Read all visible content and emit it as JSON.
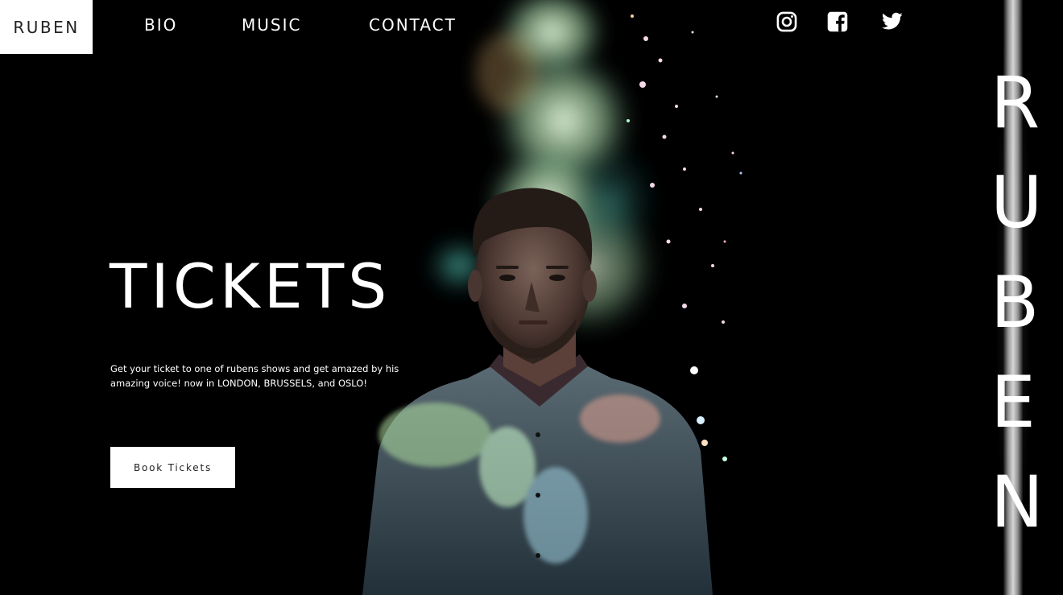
{
  "brand": {
    "logo_text": "RUBEN"
  },
  "nav": {
    "items": [
      {
        "label": "BIO"
      },
      {
        "label": "MUSIC"
      },
      {
        "label": "CONTACT"
      }
    ]
  },
  "social": {
    "items": [
      {
        "icon": "instagram-icon"
      },
      {
        "icon": "facebook-icon"
      },
      {
        "icon": "twitter-icon"
      }
    ]
  },
  "hero": {
    "title": "TICKETS",
    "description": "Get your ticket to one of rubens shows and get amazed by his amazing voice! now in LONDON, BRUSSELS, and OSLO!",
    "cta_label": "Book Tickets"
  },
  "side_rail": {
    "letters": [
      "R",
      "U",
      "B",
      "E",
      "N"
    ]
  },
  "colors": {
    "background": "#000000",
    "text": "#ffffff",
    "button_bg": "#ffffff",
    "button_text": "#222222",
    "logo_bg": "#ffffff"
  }
}
